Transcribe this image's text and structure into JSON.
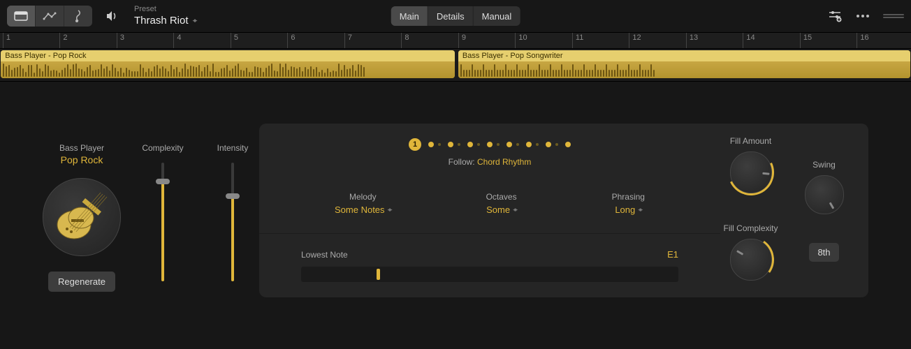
{
  "header": {
    "preset_label": "Preset",
    "preset_value": "Thrash Riot",
    "tabs": {
      "main": "Main",
      "details": "Details",
      "manual": "Manual"
    }
  },
  "ruler": {
    "bars": [
      "1",
      "2",
      "3",
      "4",
      "5",
      "6",
      "7",
      "8",
      "9",
      "10",
      "11",
      "12",
      "13",
      "14",
      "15",
      "16"
    ]
  },
  "regions": [
    {
      "name": "Bass Player - Pop Rock",
      "start_pct": 0,
      "width_pct": 49.6
    },
    {
      "name": "Bass Player - Pop Songwriter",
      "start_pct": 50.2,
      "width_pct": 49.6
    }
  ],
  "player": {
    "label": "Bass Player",
    "name": "Pop Rock",
    "regenerate": "Regenerate"
  },
  "sliders": {
    "complexity": {
      "label": "Complexity",
      "value_pct": 84
    },
    "intensity": {
      "label": "Intensity",
      "value_pct": 72
    }
  },
  "pattern": {
    "current": "1",
    "follow_label": "Follow:",
    "follow_value": "Chord Rhythm"
  },
  "selects": {
    "melody": {
      "label": "Melody",
      "value": "Some Notes"
    },
    "octaves": {
      "label": "Octaves",
      "value": "Some"
    },
    "phrasing": {
      "label": "Phrasing",
      "value": "Long"
    }
  },
  "lowest_note": {
    "label": "Lowest Note",
    "value": "E1",
    "pos_pct": 20
  },
  "knobs": {
    "fill_amount": {
      "label": "Fill Amount"
    },
    "fill_complexity": {
      "label": "Fill Complexity"
    },
    "swing": {
      "label": "Swing",
      "value_label": "8th"
    }
  }
}
